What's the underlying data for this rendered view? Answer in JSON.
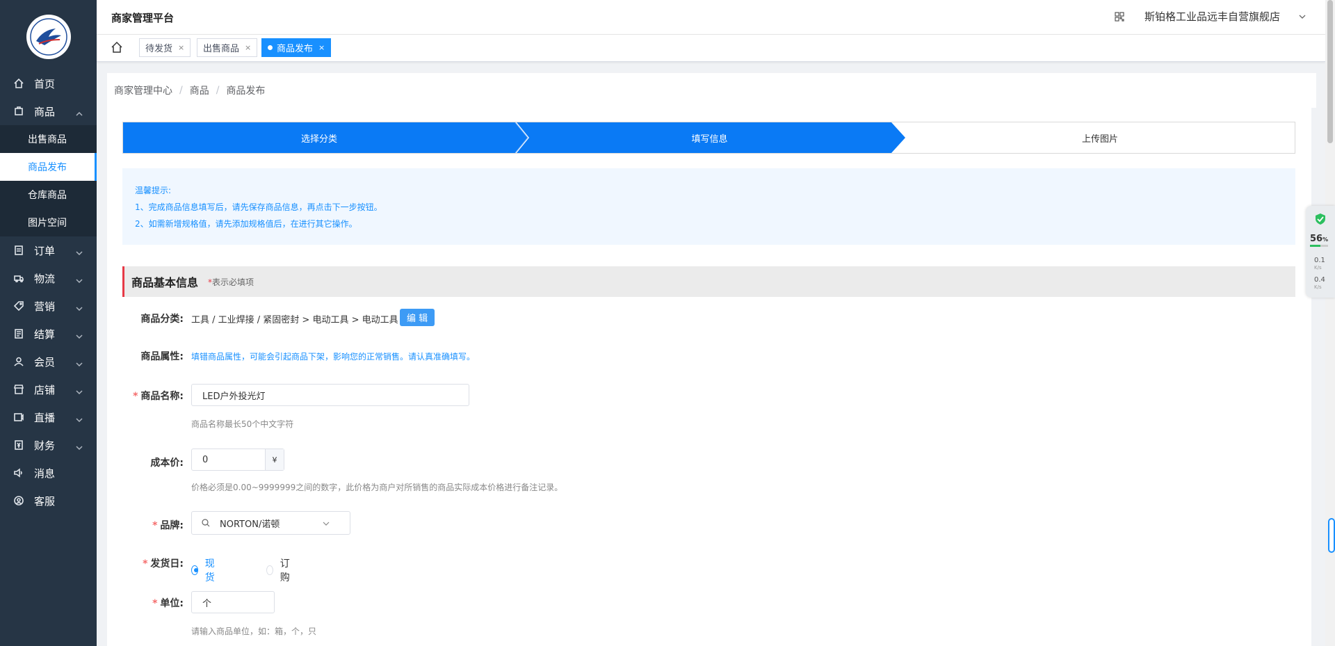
{
  "sidebar": {
    "menu": [
      {
        "label": "首页",
        "icon": "home-icon"
      },
      {
        "label": "商品",
        "icon": "goods-icon",
        "expanded": true
      },
      {
        "label": "订单",
        "icon": "order-icon"
      },
      {
        "label": "物流",
        "icon": "truck-icon"
      },
      {
        "label": "营销",
        "icon": "tag-icon"
      },
      {
        "label": "结算",
        "icon": "settlement-icon"
      },
      {
        "label": "会员",
        "icon": "user-icon"
      },
      {
        "label": "店铺",
        "icon": "shop-icon"
      },
      {
        "label": "直播",
        "icon": "live-icon"
      },
      {
        "label": "财务",
        "icon": "finance-icon"
      },
      {
        "label": "消息",
        "icon": "message-icon"
      },
      {
        "label": "客服",
        "icon": "service-icon"
      }
    ],
    "sub_goods": [
      "出售商品",
      "商品发布",
      "仓库商品",
      "图片空间"
    ]
  },
  "header": {
    "title": "商家管理平台",
    "store_name": "斯铂格工业品远丰自营旗舰店"
  },
  "tags": [
    {
      "label": "待发货",
      "close": "×"
    },
    {
      "label": "出售商品",
      "close": "×"
    },
    {
      "label": "商品发布",
      "close": "×",
      "active": true
    }
  ],
  "breadcrumb": [
    "商家管理中心",
    "商品",
    "商品发布"
  ],
  "steps": [
    "选择分类",
    "填写信息",
    "上传图片"
  ],
  "notice": {
    "title": "温馨提示:",
    "lines": [
      "1、完成商品信息填写后，请先保存商品信息，再点击下一步按钮。",
      "2、如需新增规格值，请先添加规格值后，在进行其它操作。"
    ]
  },
  "section": {
    "title": "商品基本信息",
    "note_star": "*",
    "note": "表示必填项"
  },
  "form": {
    "category": {
      "label": "商品分类:",
      "value": "工具 / 工业焊接 / 紧固密封 > 电动工具 > 电动工具",
      "edit": "编 辑"
    },
    "attributes": {
      "label": "商品属性:",
      "tip": "填错商品属性，可能会引起商品下架，影响您的正常销售。请认真准确填写。"
    },
    "name": {
      "label": "商品名称:",
      "value": "LED户外投光灯",
      "tip": "商品名称最长50个中文字符"
    },
    "cost": {
      "label": "成本价:",
      "value": "0",
      "unit": "¥",
      "tip": "价格必须是0.00~9999999之间的数字，此价格为商户对所销售的商品实际成本价格进行备注记录。"
    },
    "brand": {
      "label": "品牌:",
      "value": "NORTON/诺顿"
    },
    "ship": {
      "label": "发货日:",
      "options": [
        "现货",
        "订购"
      ],
      "selected": "现货"
    },
    "unit": {
      "label": "单位:",
      "value": "个",
      "tip": "请输入商品单位，如：箱，个，只"
    },
    "required_mark": "*"
  },
  "widget": {
    "percent": "56",
    "percent_unit": "%",
    "progress": 0.56,
    "up": "0.1",
    "down": "0.4",
    "rate_unit": "K/s"
  },
  "colors": {
    "sidebar_bg": "#263545",
    "primary": "#1890ff",
    "step_active": "#0a7af5",
    "required": "#f56c6c"
  }
}
